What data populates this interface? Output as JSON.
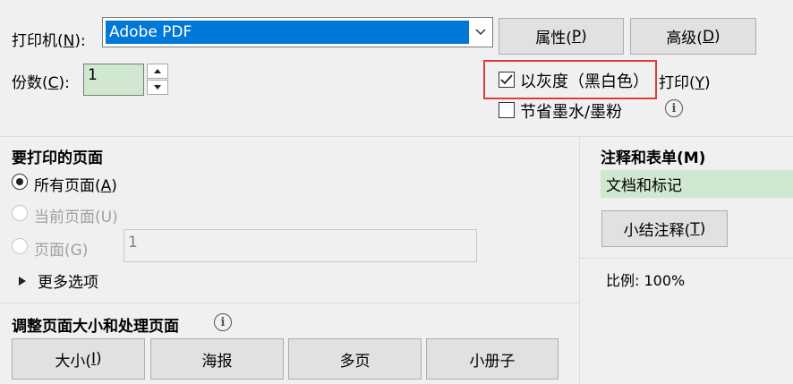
{
  "printer": {
    "label": "打印机(",
    "label_key": "N",
    "label_end": "):",
    "selected": "Adobe PDF",
    "properties_label": "属性(",
    "properties_key": "P",
    "advanced_label": "高级(",
    "advanced_key": "D"
  },
  "copies": {
    "label": "份数(",
    "label_key": "C",
    "label_end": "):",
    "value": "1"
  },
  "options": {
    "grayscale_label": "以灰度（黑白色）",
    "grayscale_tail": "打印(",
    "grayscale_key": "Y",
    "grayscale_checked": true,
    "save_ink_label": "节省墨水/墨粉",
    "save_ink_checked": false
  },
  "pages": {
    "title": "要打印的页面",
    "all_label": "所有页面(",
    "all_key": "A",
    "current_label": "当前页面(U)",
    "range_label": "页面(G)",
    "range_value": "1",
    "more_label": "更多选项"
  },
  "comments": {
    "title": "注释和表单(M)",
    "selected": "文档和标记",
    "summarize_label": "小结注释(",
    "summarize_key": "T",
    "scale_label": "比例:",
    "scale_value": "100%"
  },
  "sizing": {
    "title": "调整页面大小和处理页面",
    "size_label": "大小(",
    "size_key": "I",
    "poster_label": "海报",
    "multiple_label": "多页",
    "booklet_label": "小册子"
  },
  "colors": {
    "accent": "#0078d7",
    "highlight_field": "#cfe8cf",
    "red_box": "#e03c3c"
  }
}
